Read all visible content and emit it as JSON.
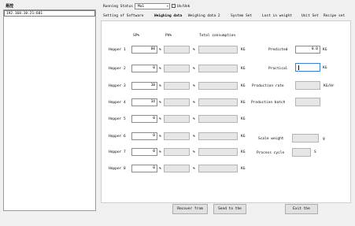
{
  "sidebar": {
    "title": "易控",
    "ip": "192.168.10.21:601"
  },
  "top": {
    "status_label": "Running Status",
    "status_value": "Ma1",
    "checkbox_label": "Un/Unk",
    "checkbox_checked": false
  },
  "tabs": [
    {
      "label": "Setting of Software",
      "active": false
    },
    {
      "label": "Weighing data",
      "active": true
    },
    {
      "label": "Weighing data 2",
      "active": false
    },
    {
      "label": "System Set",
      "active": false
    },
    {
      "label": "Lost in weight",
      "active": false
    },
    {
      "label": "Unit Set",
      "active": false
    },
    {
      "label": "Recipe set",
      "active": false
    }
  ],
  "columns": {
    "col1": "SP%",
    "col2": "PV%",
    "col3": "Total consumption"
  },
  "unit_pct": "%",
  "unit_kg": "KG",
  "hoppers": [
    {
      "label": "Hopper 1",
      "sp": "60"
    },
    {
      "label": "Hopper 2",
      "sp": "0"
    },
    {
      "label": "Hopper 3",
      "sp": "10"
    },
    {
      "label": "Hopper 4",
      "sp": "34"
    },
    {
      "label": "Hopper 5",
      "sp": "0"
    },
    {
      "label": "Hopper 6",
      "sp": "0"
    },
    {
      "label": "Hopper 7",
      "sp": "0"
    },
    {
      "label": "Hopper 8",
      "sp": "0"
    }
  ],
  "right": {
    "predicted_label": "Predicted",
    "predicted_value": "0.0",
    "predicted_unit": "KG",
    "practical_label": "Practical",
    "practical_unit": "KG",
    "production_rate_label": "Production rate",
    "production_rate_unit": "KG/Hr",
    "production_batch_label": "Production batch",
    "scale_weight_label": "Scale weight",
    "scale_weight_unit": "g",
    "process_cycle_label": "Process cycle",
    "process_cycle_unit": "S"
  },
  "buttons": {
    "recover": "Recover from",
    "send": "Send to the",
    "exit": "Exit the"
  }
}
